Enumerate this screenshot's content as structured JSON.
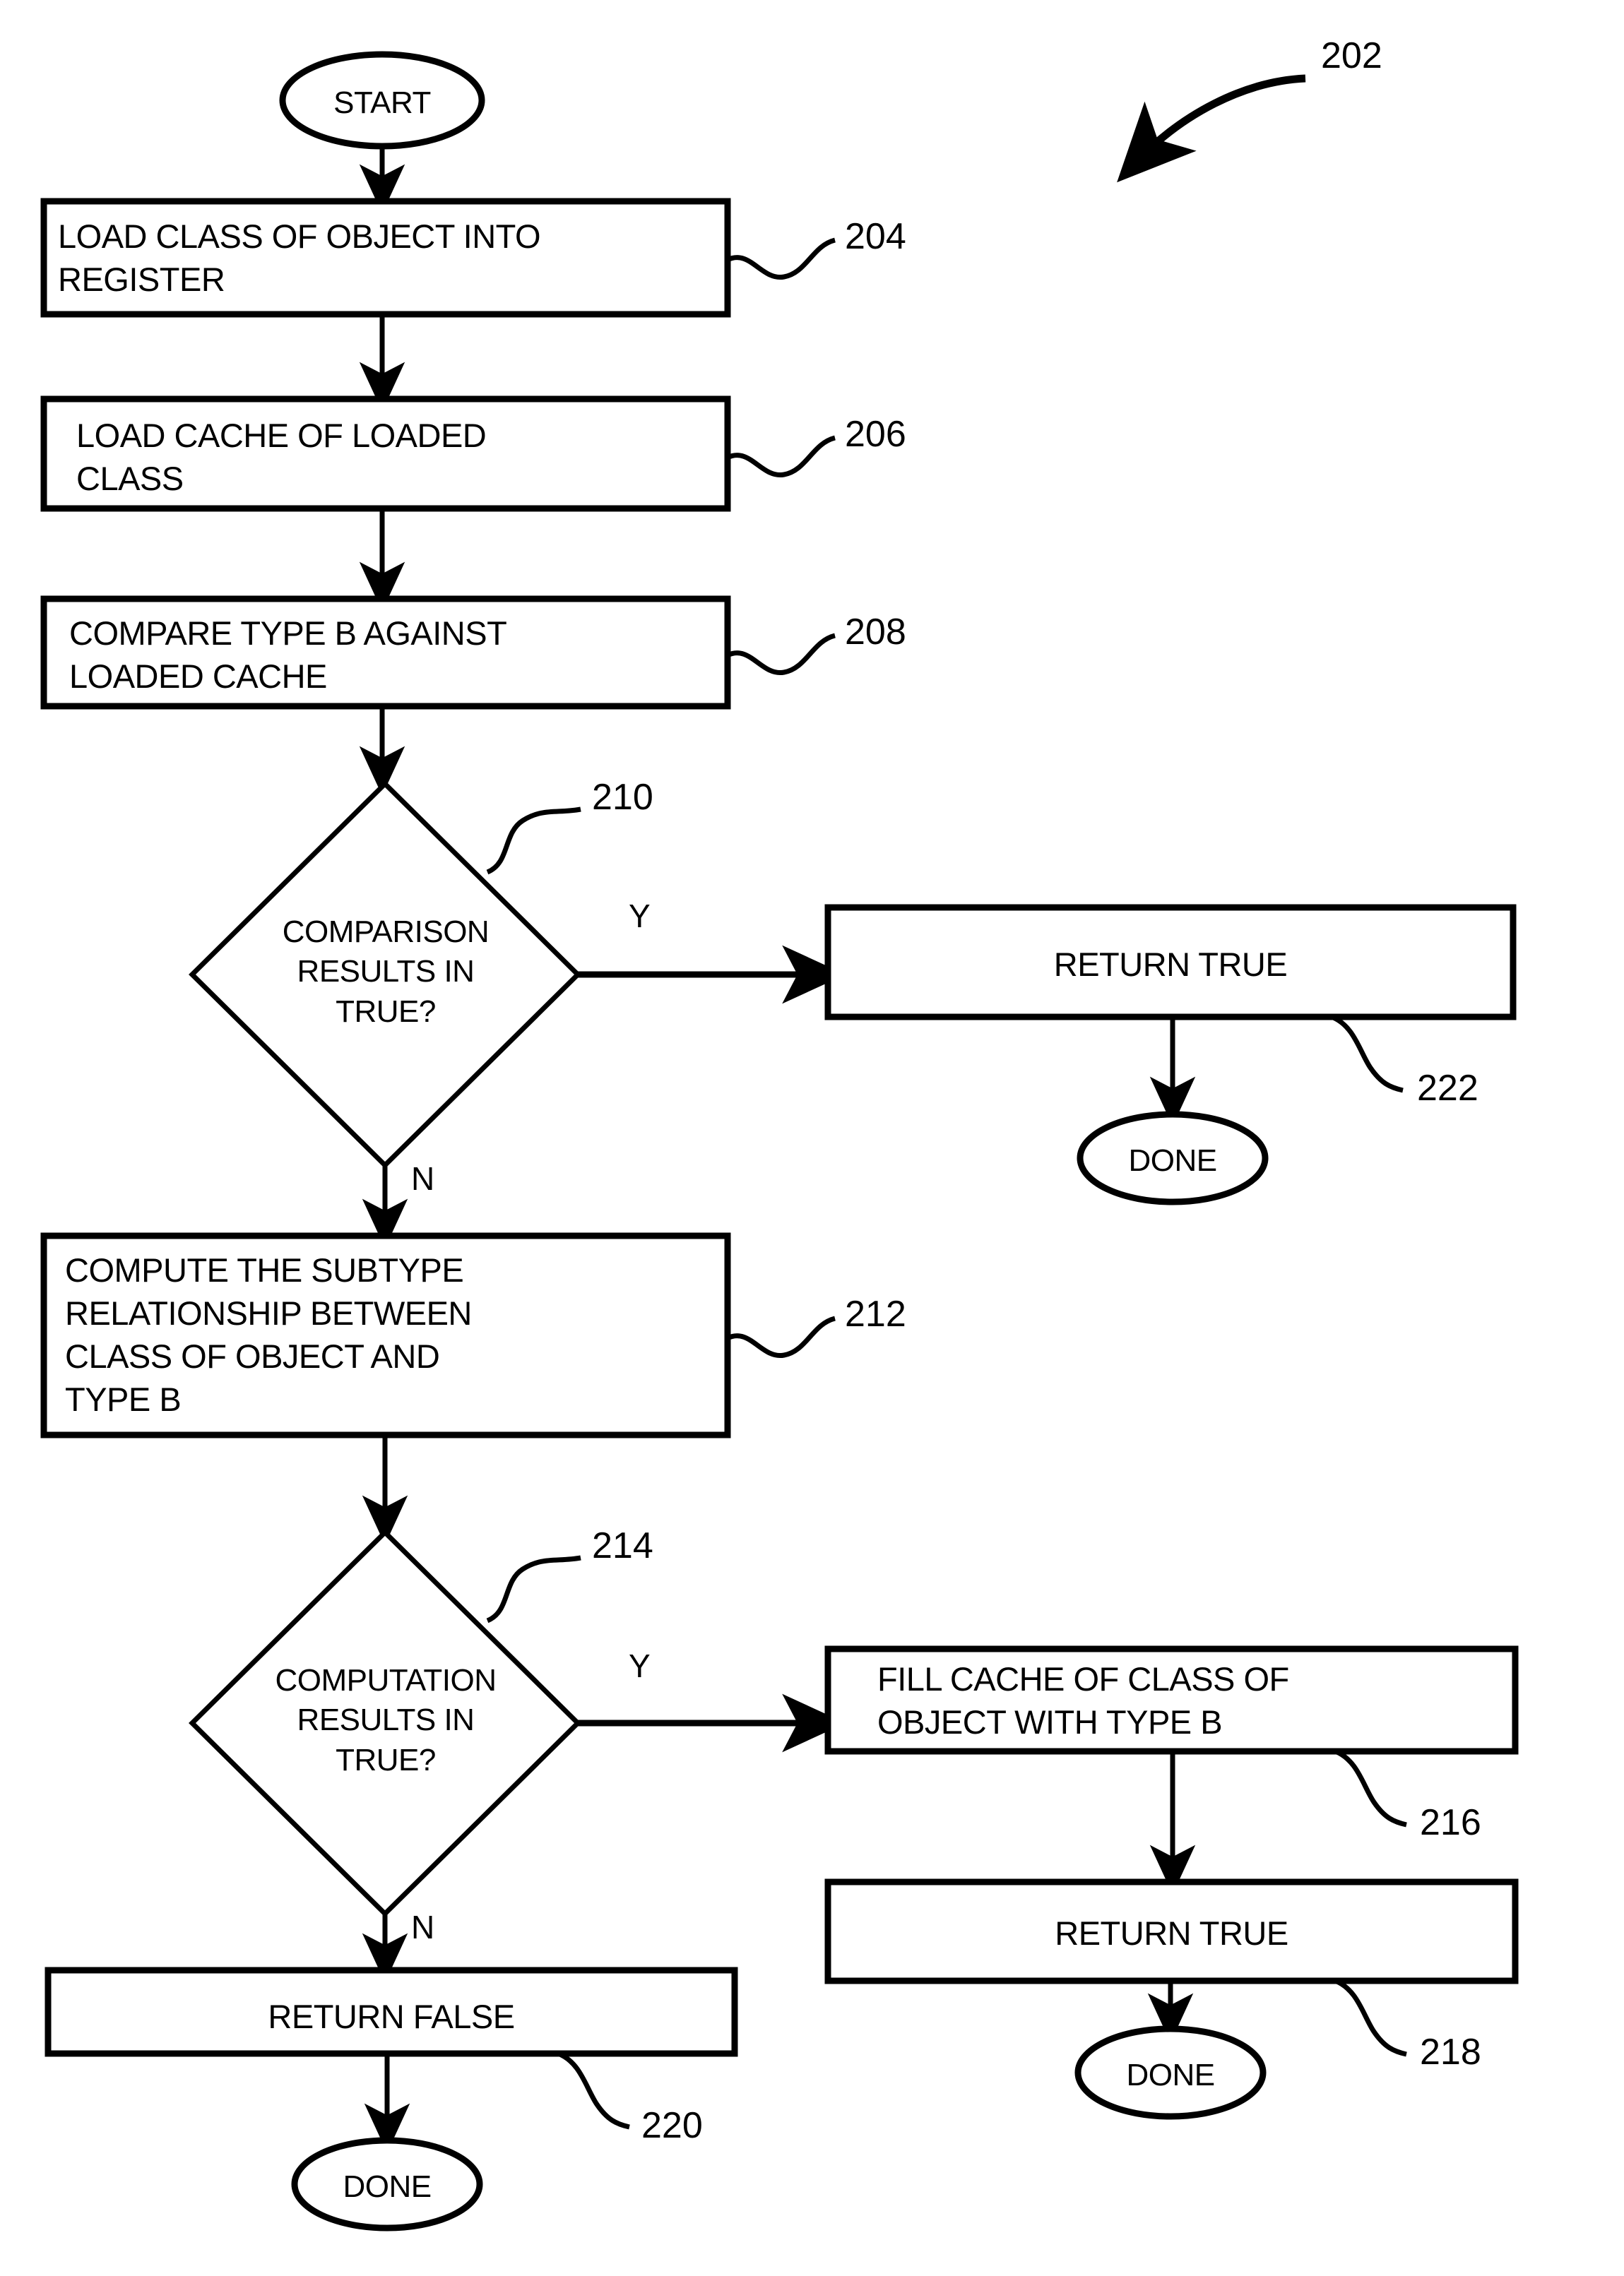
{
  "figure": {
    "reference_label": "202"
  },
  "nodes": {
    "start": {
      "label": "START",
      "shape": "oval"
    },
    "load_class": {
      "label": "LOAD CLASS OF OBJECT INTO\nREGISTER",
      "ref": "204",
      "shape": "process"
    },
    "load_cache": {
      "label": "LOAD CACHE OF LOADED\nCLASS",
      "ref": "206",
      "shape": "process"
    },
    "compare": {
      "label": "COMPARE TYPE B AGAINST\nLOADED CACHE",
      "ref": "208",
      "shape": "process"
    },
    "comparison_decision": {
      "label": "COMPARISON\nRESULTS IN\nTRUE?",
      "ref": "210",
      "shape": "decision"
    },
    "return_true_1": {
      "label": "RETURN TRUE",
      "ref": "222",
      "shape": "process"
    },
    "done_1": {
      "label": "DONE",
      "shape": "oval"
    },
    "compute_subtype": {
      "label": "COMPUTE THE SUBTYPE\nRELATIONSHIP BETWEEN\nCLASS OF OBJECT AND\nTYPE B",
      "ref": "212",
      "shape": "process"
    },
    "computation_decision": {
      "label": "COMPUTATION\nRESULTS IN\nTRUE?",
      "ref": "214",
      "shape": "decision"
    },
    "fill_cache": {
      "label": "FILL CACHE OF CLASS OF\nOBJECT WITH TYPE B",
      "ref": "216",
      "shape": "process"
    },
    "return_true_2": {
      "label": "RETURN TRUE",
      "ref": "218",
      "shape": "process"
    },
    "done_2": {
      "label": "DONE",
      "shape": "oval"
    },
    "return_false": {
      "label": "RETURN FALSE",
      "ref": "220",
      "shape": "process"
    },
    "done_3": {
      "label": "DONE",
      "shape": "oval"
    }
  },
  "branch_labels": {
    "comparison_yes": "Y",
    "comparison_no": "N",
    "computation_yes": "Y",
    "computation_no": "N"
  },
  "style": {
    "stroke": "#000000",
    "fill": "#ffffff",
    "background": "#ffffff"
  }
}
